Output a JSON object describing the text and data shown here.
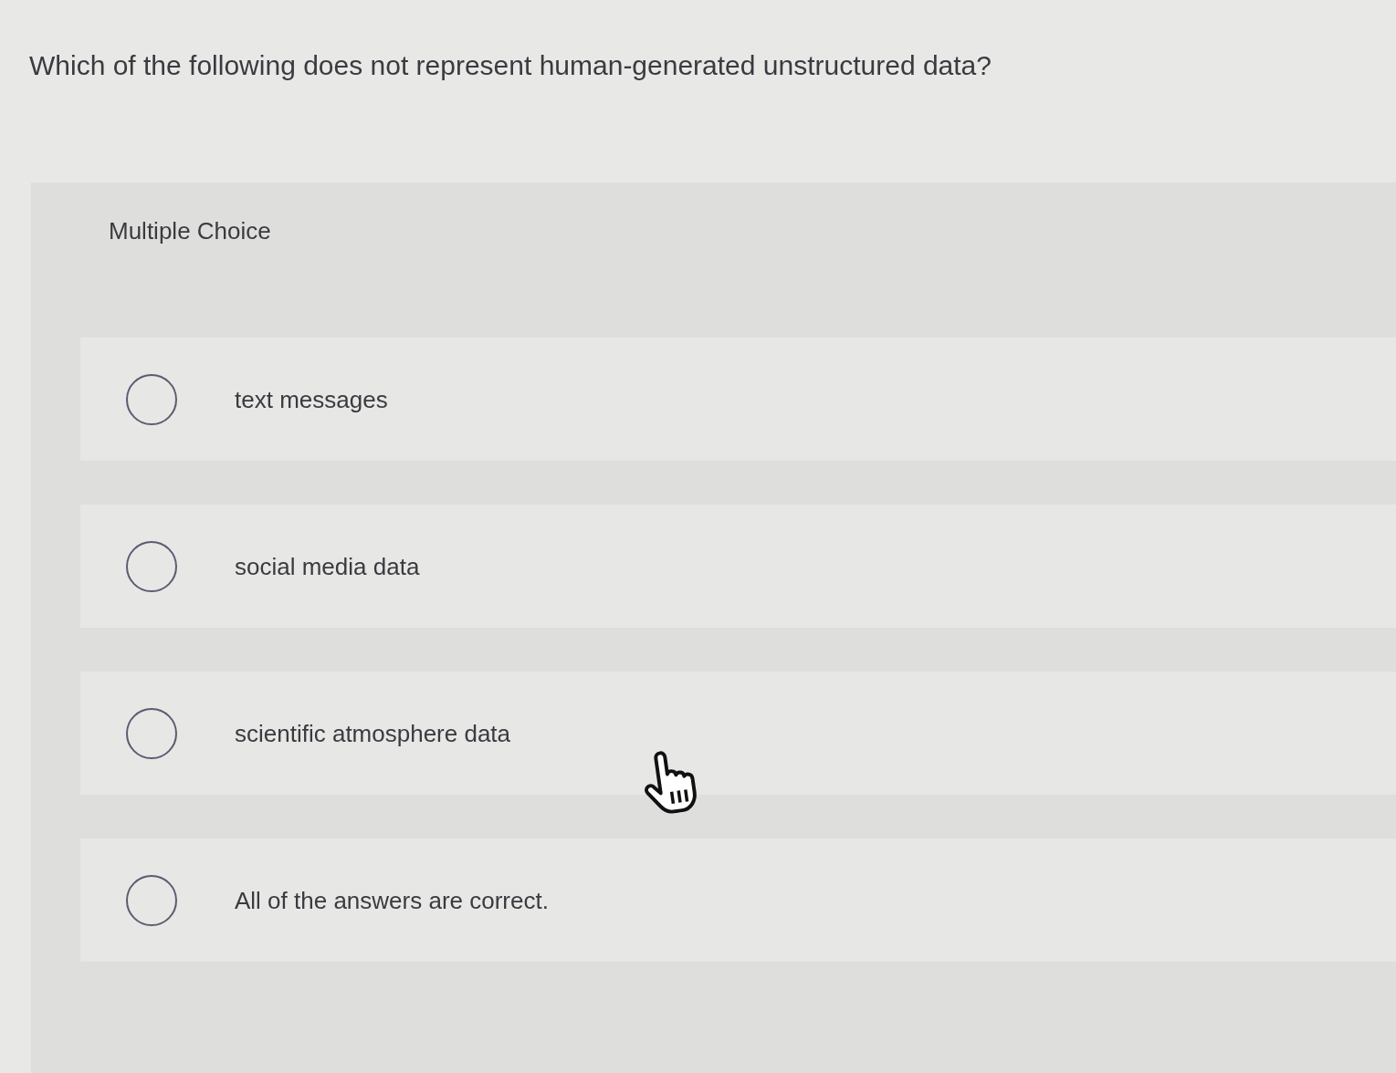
{
  "question": "Which of the following does not represent human-generated unstructured data?",
  "panel": {
    "heading": "Multiple Choice",
    "options": [
      {
        "label": "text messages",
        "selected": false
      },
      {
        "label": "social media data",
        "selected": false
      },
      {
        "label": "scientific atmosphere data",
        "selected": false
      },
      {
        "label": "All of the answers are correct.",
        "selected": false
      }
    ]
  }
}
